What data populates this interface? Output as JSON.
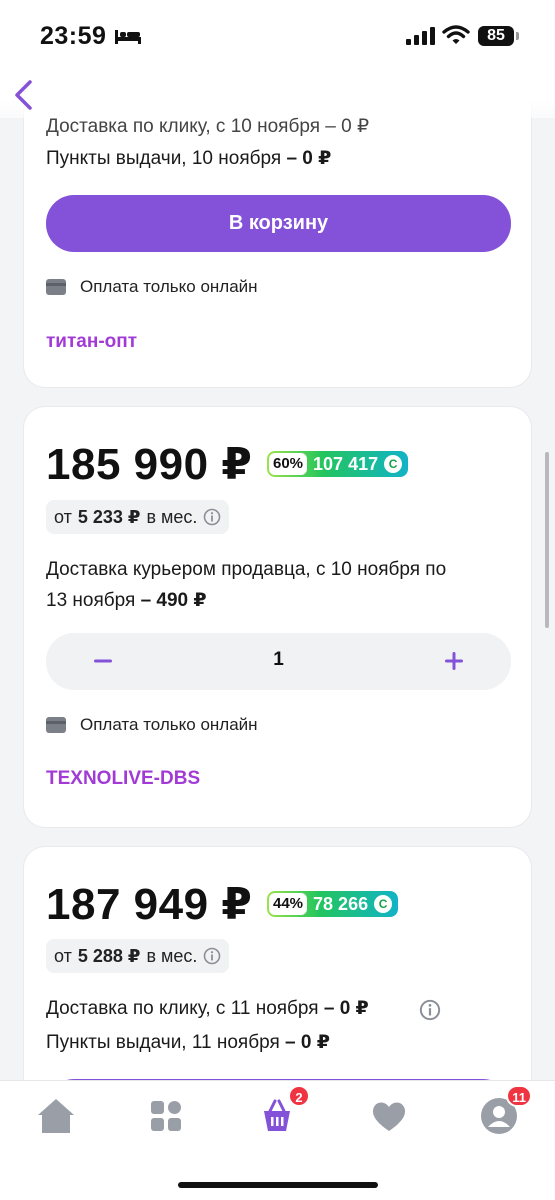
{
  "status_bar": {
    "time": "23:59",
    "battery": "85"
  },
  "card1": {
    "delivery_partial": "Доставка по клику, с 10 ноября – 0 ₽",
    "pickup_text": "Пункты выдачи, 10 ноября",
    "pickup_price": "– 0 ₽",
    "cart_button": "В корзину",
    "payment_note": "Оплата только онлайн",
    "seller": "титан-опт"
  },
  "card2": {
    "price": "185 990 ₽",
    "bonus_percent": "60%",
    "bonus_value": "107 417",
    "install_prefix": "от",
    "install_amount": "5 233 ₽",
    "install_suffix": "в мес.",
    "delivery_line1": "Доставка курьером продавца, с 10 ноября по",
    "delivery_line2": "13 ноября",
    "delivery_price": "– 490 ₽",
    "quantity": "1",
    "payment_note": "Оплата только онлайн",
    "seller": "TEXNOLIVE-DBS"
  },
  "card3": {
    "price": "187 949 ₽",
    "bonus_percent": "44%",
    "bonus_value": "78 266",
    "install_prefix": "от",
    "install_amount": "5 288 ₽",
    "install_suffix": "в мес.",
    "delivery_text": "Доставка по клику, с 11 ноября",
    "delivery_price": "– 0 ₽",
    "pickup_text": "Пункты выдачи, 11 ноября",
    "pickup_price": "– 0 ₽"
  },
  "tab_bar": {
    "items": [
      "home-icon",
      "catalog-icon",
      "cart-icon",
      "favorites-icon",
      "profile-icon"
    ],
    "cart_badge": "2",
    "profile_badge": "11"
  },
  "colors": {
    "accent": "#8452d8",
    "seller": "#a23bd6",
    "badge": "#ef3340"
  }
}
